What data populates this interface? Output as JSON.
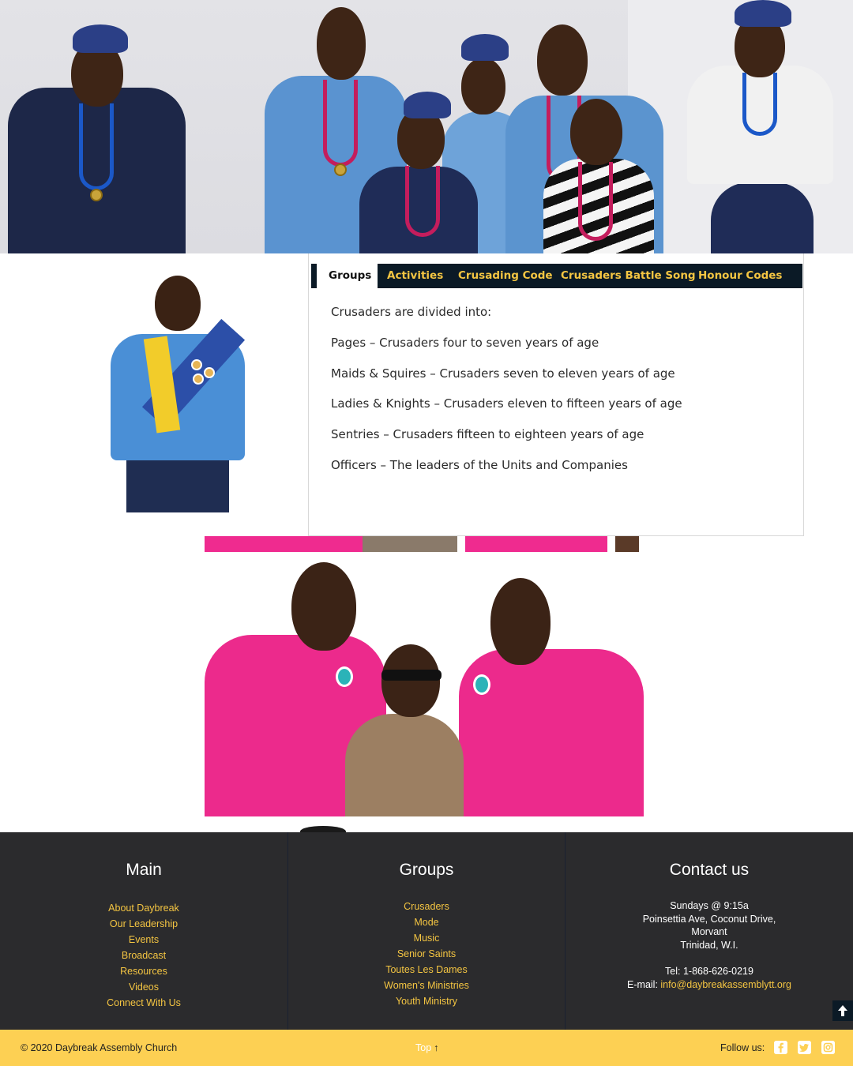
{
  "tabs": [
    {
      "label": "Groups",
      "active": true
    },
    {
      "label": "Activities",
      "active": false
    },
    {
      "label": "Crusading Code",
      "active": false
    },
    {
      "label": "Crusaders Battle Song",
      "active": false
    },
    {
      "label": "Honour Codes",
      "active": false
    }
  ],
  "groups_content": {
    "intro": "Crusaders are divided into:",
    "items": [
      "Pages – Crusaders four to seven years of age",
      "Maids & Squires – Crusaders seven to eleven years of age",
      "Ladies & Knights – Crusaders eleven to fifteen years of age",
      "Sentries – Crusaders fifteen to eighteen years of age",
      "Officers – The leaders of the Units and Companies"
    ]
  },
  "footer": {
    "main": {
      "title": "Main",
      "links": [
        "About Daybreak",
        "Our Leadership",
        "Events",
        "Broadcast",
        "Resources",
        "Videos",
        "Connect With Us"
      ]
    },
    "groups": {
      "title": "Groups",
      "links": [
        "Crusaders",
        "Mode",
        "Music",
        "Senior Saints",
        "Toutes Les Dames",
        "Women's Ministries",
        "Youth Ministry"
      ]
    },
    "contact": {
      "title": "Contact us",
      "lines": [
        "Sundays @ 9:15a",
        "Poinsettia Ave, Coconut Drive,",
        "Morvant",
        "Trinidad, W.I."
      ],
      "tel": "Tel: 1-868-626-0219",
      "email_label": "E-mail: ",
      "email": "info@daybreakassemblytt.org"
    }
  },
  "bottom_bar": {
    "copyright": "© 2020 Daybreak Assembly Church",
    "top_label": "Top",
    "top_arrow": "↑",
    "follow_label": "Follow us:",
    "social": [
      "facebook-icon",
      "twitter-icon",
      "instagram-icon"
    ]
  },
  "colors": {
    "accent": "#f4c542",
    "tabbar": "#0b1a26",
    "footer_bg": "#2b2b2d",
    "bottom_bar_bg": "#fdd053"
  },
  "images": {
    "hero": "hero-photo-crusaders-uniforms",
    "side": "boy-crusader-photo",
    "group": "group-photo-pink-shirts"
  }
}
